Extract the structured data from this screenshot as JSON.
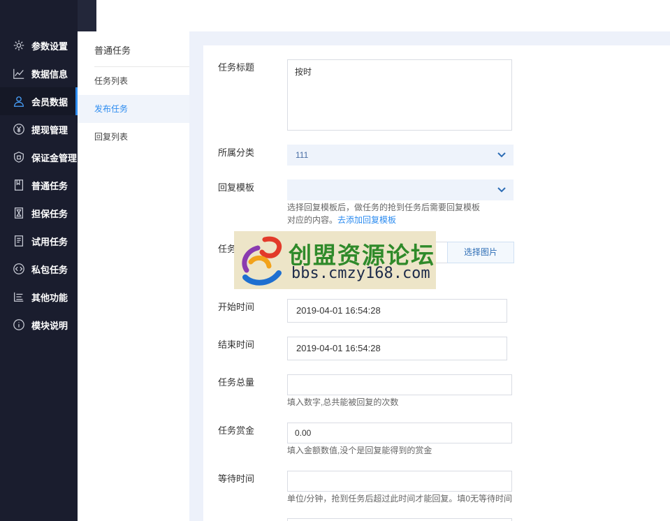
{
  "sidebar": {
    "items": [
      {
        "label": "参数设置",
        "icon": "gear-icon"
      },
      {
        "label": "数据信息",
        "icon": "chart-line-icon"
      },
      {
        "label": "会员数据",
        "icon": "user-icon"
      },
      {
        "label": "提现管理",
        "icon": "yen-icon"
      },
      {
        "label": "保证金管理",
        "icon": "shield-icon"
      },
      {
        "label": "普通任务",
        "icon": "bookmark-icon"
      },
      {
        "label": "担保任务",
        "icon": "hourglass-icon"
      },
      {
        "label": "试用任务",
        "icon": "document-icon"
      },
      {
        "label": "私包任务",
        "icon": "code-icon"
      },
      {
        "label": "其他功能",
        "icon": "list-icon"
      },
      {
        "label": "模块说明",
        "icon": "info-icon"
      }
    ],
    "active_index": 2
  },
  "subnav": {
    "title": "普通任务",
    "items": [
      "任务列表",
      "发布任务",
      "回复列表"
    ],
    "active_index": 1
  },
  "form": {
    "title_label": "任务标题",
    "title_value": "按时",
    "category_label": "所属分类",
    "category_value": "111",
    "template_label": "回复模板",
    "template_value": "",
    "template_hint": "选择回复模板后，做任务的抢到任务后需要回复模板",
    "template_hint2": "对应的内容。",
    "template_link": "去添加回复模板",
    "image_label": "任务",
    "image_button": "选择图片",
    "start_label": "开始时间",
    "start_value": "2019-04-01 16:54:28",
    "end_label": "结束时间",
    "end_value": "2019-04-01 16:54:28",
    "total_label": "任务总量",
    "total_value": "",
    "total_hint": "填入数字,总共能被回复的次数",
    "reward_label": "任务赏金",
    "reward_value": "0.00",
    "reward_hint": "填入金额数值,没个是回复能得到的赏金",
    "wait_label": "等待时间",
    "wait_value": "",
    "wait_hint": "单位/分钟，抢到任务后超过此时间才能回复。填0无等待时间"
  },
  "watermark": {
    "title": "创盟资源论坛",
    "subtitle": "bbs.cmzy168.com"
  },
  "colors": {
    "sidebar_bg": "#1a1d2e",
    "accent": "#2d8cf0",
    "content_bg": "#edf1fa"
  }
}
